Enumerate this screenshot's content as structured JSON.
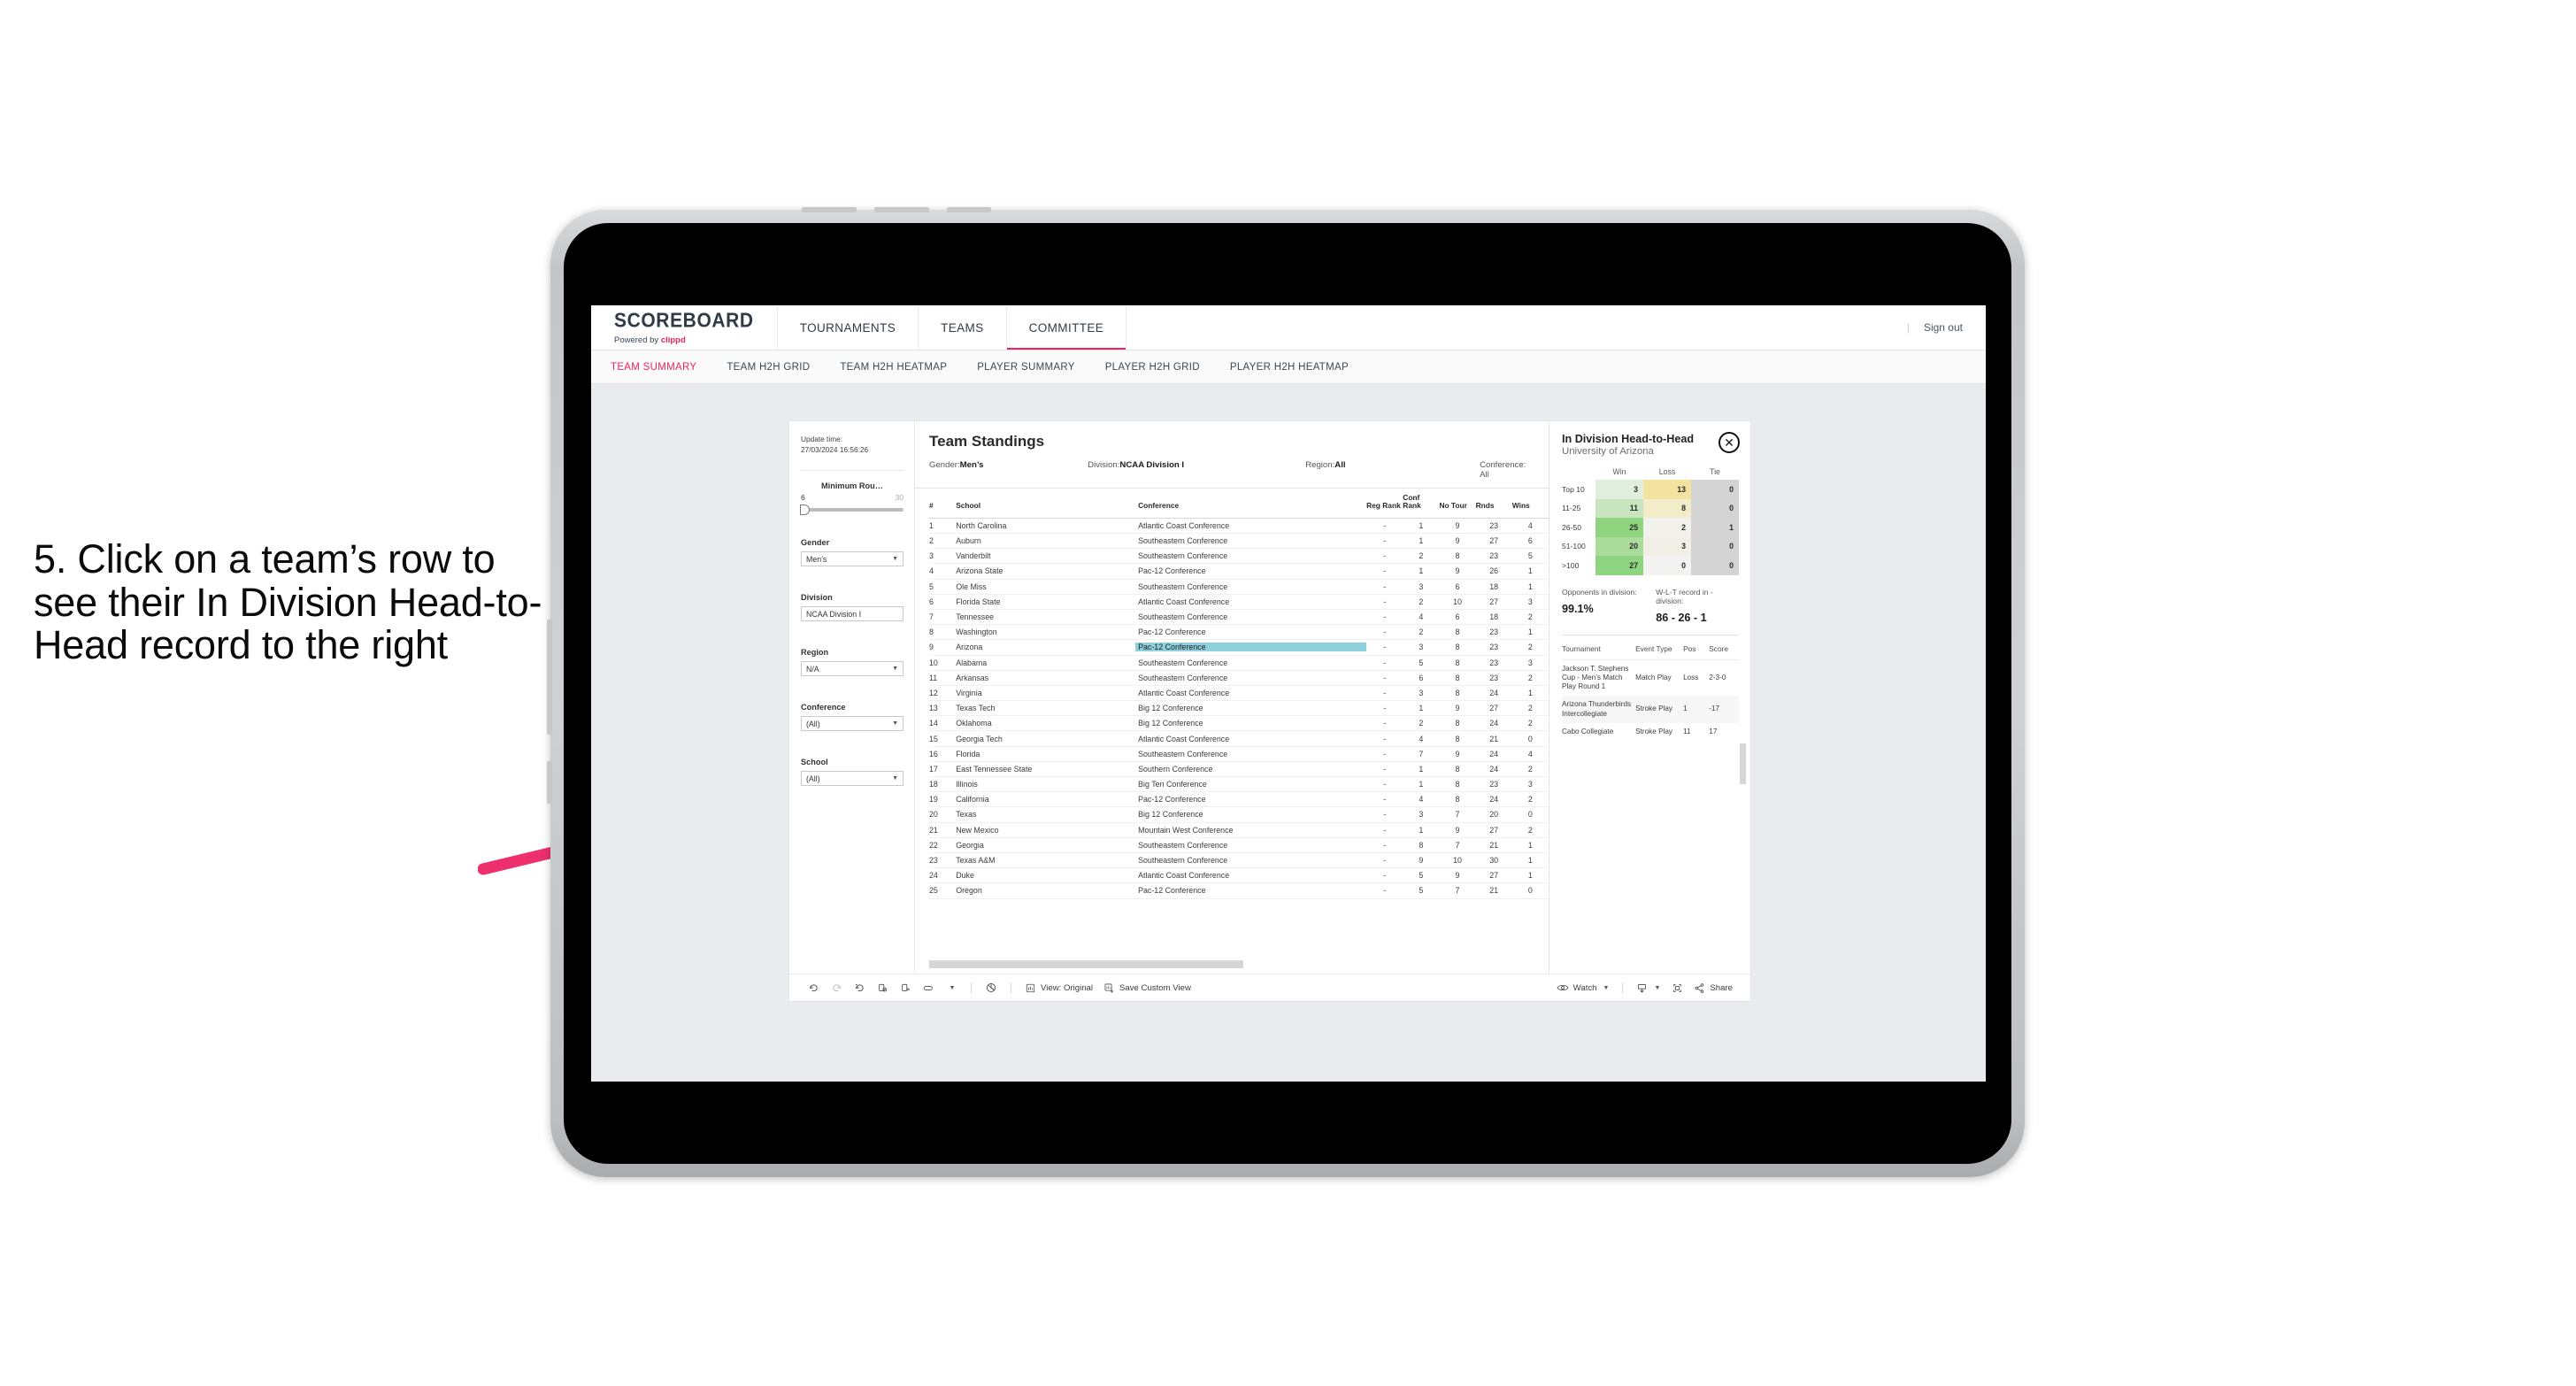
{
  "annotation": {
    "text": "5. Click on a team’s row to see their In Division Head-to-Head record to the right",
    "arrow_color": "#ed2f6e"
  },
  "header": {
    "logo_main": "SCOREBOARD",
    "logo_powered": "Powered by ",
    "logo_brand": "clippd",
    "nav": [
      {
        "label": "TOURNAMENTS",
        "active": false
      },
      {
        "label": "TEAMS",
        "active": false
      },
      {
        "label": "COMMITTEE",
        "active": true
      }
    ],
    "divider": "|",
    "signout": "Sign out"
  },
  "subnav": [
    {
      "label": "TEAM SUMMARY",
      "active": true
    },
    {
      "label": "TEAM H2H GRID",
      "active": false
    },
    {
      "label": "TEAM H2H HEATMAP",
      "active": false
    },
    {
      "label": "PLAYER SUMMARY",
      "active": false
    },
    {
      "label": "PLAYER H2H GRID",
      "active": false
    },
    {
      "label": "PLAYER H2H HEATMAP",
      "active": false
    }
  ],
  "filters": {
    "update_label": "Update time:",
    "update_value": "27/03/2024 16:56:26",
    "slider": {
      "title": "Minimum Rou…",
      "min": "6",
      "max": "30"
    },
    "fields": [
      {
        "label": "Gender",
        "value": "Men’s"
      },
      {
        "label": "Division",
        "value": "NCAA Division I"
      },
      {
        "label": "Region",
        "value": "N/A"
      },
      {
        "label": "Conference",
        "value": "(All)"
      },
      {
        "label": "School",
        "value": "(All)"
      }
    ]
  },
  "standings": {
    "title": "Team Standings",
    "meta": [
      {
        "label": "Gender: ",
        "value": "Men’s"
      },
      {
        "label": "Division: ",
        "value": "NCAA Division I"
      },
      {
        "label": "Region: ",
        "value": "All"
      },
      {
        "label": "Conference: ",
        "value": "All"
      }
    ],
    "columns": [
      "#",
      "School",
      "Conference",
      "Reg Rank",
      "Conf Rank",
      "No Tour",
      "Rnds",
      "Wins"
    ],
    "highlighted_row": 9,
    "rows": [
      {
        "rank": "1",
        "school": "North Carolina",
        "conference": "Atlantic Coast Conference",
        "reg_rank": "-",
        "conf_rank": "1",
        "no_tour": "9",
        "rnds": "23",
        "wins": "4"
      },
      {
        "rank": "2",
        "school": "Auburn",
        "conference": "Southeastern Conference",
        "reg_rank": "-",
        "conf_rank": "1",
        "no_tour": "9",
        "rnds": "27",
        "wins": "6"
      },
      {
        "rank": "3",
        "school": "Vanderbilt",
        "conference": "Southeastern Conference",
        "reg_rank": "-",
        "conf_rank": "2",
        "no_tour": "8",
        "rnds": "23",
        "wins": "5"
      },
      {
        "rank": "4",
        "school": "Arizona State",
        "conference": "Pac-12 Conference",
        "reg_rank": "-",
        "conf_rank": "1",
        "no_tour": "9",
        "rnds": "26",
        "wins": "1"
      },
      {
        "rank": "5",
        "school": "Ole Miss",
        "conference": "Southeastern Conference",
        "reg_rank": "-",
        "conf_rank": "3",
        "no_tour": "6",
        "rnds": "18",
        "wins": "1"
      },
      {
        "rank": "6",
        "school": "Florida State",
        "conference": "Atlantic Coast Conference",
        "reg_rank": "-",
        "conf_rank": "2",
        "no_tour": "10",
        "rnds": "27",
        "wins": "3"
      },
      {
        "rank": "7",
        "school": "Tennessee",
        "conference": "Southeastern Conference",
        "reg_rank": "-",
        "conf_rank": "4",
        "no_tour": "6",
        "rnds": "18",
        "wins": "2"
      },
      {
        "rank": "8",
        "school": "Washington",
        "conference": "Pac-12 Conference",
        "reg_rank": "-",
        "conf_rank": "2",
        "no_tour": "8",
        "rnds": "23",
        "wins": "1"
      },
      {
        "rank": "9",
        "school": "Arizona",
        "conference": "Pac-12 Conference",
        "reg_rank": "-",
        "conf_rank": "3",
        "no_tour": "8",
        "rnds": "23",
        "wins": "2"
      },
      {
        "rank": "10",
        "school": "Alabama",
        "conference": "Southeastern Conference",
        "reg_rank": "-",
        "conf_rank": "5",
        "no_tour": "8",
        "rnds": "23",
        "wins": "3"
      },
      {
        "rank": "11",
        "school": "Arkansas",
        "conference": "Southeastern Conference",
        "reg_rank": "-",
        "conf_rank": "6",
        "no_tour": "8",
        "rnds": "23",
        "wins": "2"
      },
      {
        "rank": "12",
        "school": "Virginia",
        "conference": "Atlantic Coast Conference",
        "reg_rank": "-",
        "conf_rank": "3",
        "no_tour": "8",
        "rnds": "24",
        "wins": "1"
      },
      {
        "rank": "13",
        "school": "Texas Tech",
        "conference": "Big 12 Conference",
        "reg_rank": "-",
        "conf_rank": "1",
        "no_tour": "9",
        "rnds": "27",
        "wins": "2"
      },
      {
        "rank": "14",
        "school": "Oklahoma",
        "conference": "Big 12 Conference",
        "reg_rank": "-",
        "conf_rank": "2",
        "no_tour": "8",
        "rnds": "24",
        "wins": "2"
      },
      {
        "rank": "15",
        "school": "Georgia Tech",
        "conference": "Atlantic Coast Conference",
        "reg_rank": "-",
        "conf_rank": "4",
        "no_tour": "8",
        "rnds": "21",
        "wins": "0"
      },
      {
        "rank": "16",
        "school": "Florida",
        "conference": "Southeastern Conference",
        "reg_rank": "-",
        "conf_rank": "7",
        "no_tour": "9",
        "rnds": "24",
        "wins": "4"
      },
      {
        "rank": "17",
        "school": "East Tennessee State",
        "conference": "Southern Conference",
        "reg_rank": "-",
        "conf_rank": "1",
        "no_tour": "8",
        "rnds": "24",
        "wins": "2"
      },
      {
        "rank": "18",
        "school": "Illinois",
        "conference": "Big Ten Conference",
        "reg_rank": "-",
        "conf_rank": "1",
        "no_tour": "8",
        "rnds": "23",
        "wins": "3"
      },
      {
        "rank": "19",
        "school": "California",
        "conference": "Pac-12 Conference",
        "reg_rank": "-",
        "conf_rank": "4",
        "no_tour": "8",
        "rnds": "24",
        "wins": "2"
      },
      {
        "rank": "20",
        "school": "Texas",
        "conference": "Big 12 Conference",
        "reg_rank": "-",
        "conf_rank": "3",
        "no_tour": "7",
        "rnds": "20",
        "wins": "0"
      },
      {
        "rank": "21",
        "school": "New Mexico",
        "conference": "Mountain West Conference",
        "reg_rank": "-",
        "conf_rank": "1",
        "no_tour": "9",
        "rnds": "27",
        "wins": "2"
      },
      {
        "rank": "22",
        "school": "Georgia",
        "conference": "Southeastern Conference",
        "reg_rank": "-",
        "conf_rank": "8",
        "no_tour": "7",
        "rnds": "21",
        "wins": "1"
      },
      {
        "rank": "23",
        "school": "Texas A&M",
        "conference": "Southeastern Conference",
        "reg_rank": "-",
        "conf_rank": "9",
        "no_tour": "10",
        "rnds": "30",
        "wins": "1"
      },
      {
        "rank": "24",
        "school": "Duke",
        "conference": "Atlantic Coast Conference",
        "reg_rank": "-",
        "conf_rank": "5",
        "no_tour": "9",
        "rnds": "27",
        "wins": "1"
      },
      {
        "rank": "25",
        "school": "Oregon",
        "conference": "Pac-12 Conference",
        "reg_rank": "-",
        "conf_rank": "5",
        "no_tour": "7",
        "rnds": "21",
        "wins": "0"
      }
    ]
  },
  "h2h": {
    "title": "In Division Head-to-Head",
    "subtitle": "University of Arizona",
    "close_icon": "✕",
    "matrix": {
      "columns": [
        "Win",
        "Loss",
        "Tie"
      ],
      "rows": [
        {
          "label": "Top 10",
          "win": "3",
          "loss": "13",
          "tie": "0",
          "win_bg": "#e2efe0",
          "loss_bg": "#f2e3a0",
          "tie_bg": "#d4d4d4"
        },
        {
          "label": "11-25",
          "win": "11",
          "loss": "8",
          "tie": "0",
          "win_bg": "#c8e5bf",
          "loss_bg": "#f2ecc9",
          "tie_bg": "#d4d4d4"
        },
        {
          "label": "26-50",
          "win": "25",
          "loss": "2",
          "tie": "1",
          "win_bg": "#8fd47e",
          "loss_bg": "#f2f1ec",
          "tie_bg": "#d4d4d4"
        },
        {
          "label": "51-100",
          "win": "20",
          "loss": "3",
          "tie": "0",
          "win_bg": "#abdc9c",
          "loss_bg": "#f2efe6",
          "tie_bg": "#d4d4d4"
        },
        {
          "label": ">100",
          "win": "27",
          "loss": "0",
          "tie": "0",
          "win_bg": "#8fd47e",
          "loss_bg": "#f3f3f1",
          "tie_bg": "#d4d4d4"
        }
      ]
    },
    "stats": [
      {
        "label": "Opponents in division:",
        "value": "99.1%"
      },
      {
        "label": "W-L-T record in -division:",
        "value": "86 - 26 - 1"
      }
    ],
    "tournament_columns": [
      "Tournament",
      "Event Type",
      "Pos",
      "Score"
    ],
    "tournaments": [
      {
        "name": "Jackson T. Stephens Cup - Men’s Match Play Round 1",
        "event_type": "Match Play",
        "pos": "Loss",
        "score": "2-3-0"
      },
      {
        "name": "Arizona Thunderbirds Intercollegiate",
        "event_type": "Stroke Play",
        "pos": "1",
        "score": "-17"
      },
      {
        "name": "Cabo Collegiate",
        "event_type": "Stroke Play",
        "pos": "11",
        "score": "17"
      }
    ]
  },
  "toolbar": {
    "icons": [
      "undo-icon",
      "redo-icon",
      "revert-icon",
      "refresh-icon",
      "pause-icon",
      "rectangle-select-icon"
    ],
    "view_label": "View: Original",
    "save_label": "Save Custom View",
    "watch_label": "Watch",
    "share_label": "Share",
    "separator": "|"
  },
  "chart_data": {
    "type": "heatmap",
    "title": "In Division Head-to-Head — University of Arizona",
    "xlabel": "",
    "ylabel": "",
    "categories": [
      "Top 10",
      "11-25",
      "26-50",
      "51-100",
      ">100"
    ],
    "series": [
      {
        "name": "Win",
        "values": [
          3,
          11,
          25,
          20,
          27
        ]
      },
      {
        "name": "Loss",
        "values": [
          13,
          8,
          2,
          3,
          0
        ]
      },
      {
        "name": "Tie",
        "values": [
          0,
          0,
          1,
          0,
          0
        ]
      }
    ],
    "annotations": {
      "opponents_in_division": "99.1%",
      "wlt_record": "86 - 26 - 1"
    }
  }
}
